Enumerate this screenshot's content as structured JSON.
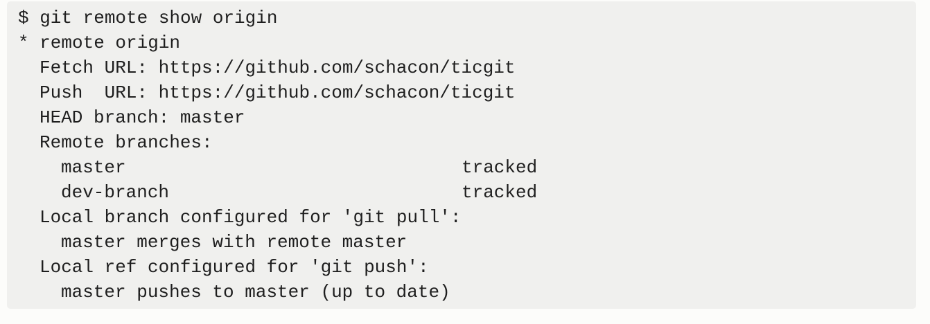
{
  "terminal": {
    "command_line": "$ git remote show origin",
    "remote_header": "* remote origin",
    "fetch_url": "Fetch URL: https://github.com/schacon/ticgit",
    "push_url": "Push  URL: https://github.com/schacon/ticgit",
    "head_branch": "HEAD branch: master",
    "remote_branches_header": "Remote branches:",
    "remote_branches": [
      {
        "name": "master",
        "status": "tracked"
      },
      {
        "name": "dev-branch",
        "status": "tracked"
      }
    ],
    "pull_header": "Local branch configured for 'git pull':",
    "pull_detail": "master merges with remote master",
    "push_header": "Local ref configured for 'git push':",
    "push_detail": "master pushes to master (up to date)"
  }
}
